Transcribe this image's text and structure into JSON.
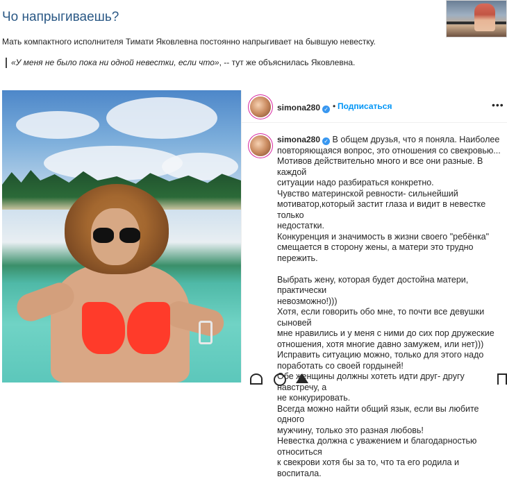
{
  "article": {
    "title": "Чо напрыгиваешь?",
    "paragraph": "Мать компактного исполнителя Тимати Яковлевна постоянно напрыгивает на бывшую невестку.",
    "quote_italic": "«У меня не было пока ни одной невестки, если что»",
    "quote_rest": ", -- тут же объяснилась Яковлевна."
  },
  "instagram": {
    "username": "simona280",
    "follow_label": "Подписаться",
    "dot": "•",
    "more_label": "•••",
    "caption_lines": [
      "В общем друзья, что я поняла. Наиболее",
      "повторяющаяся вопрос, это отношения со свекровью...",
      "Мотивов действительно много и все они разные. В каждой",
      "ситуации надо разбираться конкретно.",
      "Чувство материнской ревности- сильнейший",
      "мотиватор,который застит глаза и видит в невестке только",
      "недостатки.",
      "Конкуренция и значимость в жизни своего \"ребёнка\"",
      "смещается в сторону жены, а матери это трудно пережить.",
      "",
      "Выбрать жену, которая будет достойна матери, практически",
      "невозможно!)))",
      "Хотя, если говорить обо мне, то почти все девушки сыновей",
      "мне нравились и у меня с ними до сих пор дружеские",
      "отношения, хотя многие давно замужем, или нет)))",
      "Исправить ситуацию можно, только для этого надо",
      "поработать со своей гордыней!",
      "Обе женщины должны хотеть идти друг- другу навстречу, а",
      "не конкурировать.",
      "Всегда можно найти общий язык, если вы любите одного",
      "мужчину, только это разная любовь!",
      "Невестка должна с уважением и благодарностью относиться",
      "к свекрови хотя бы за то, что та его родила и воспитала."
    ]
  }
}
